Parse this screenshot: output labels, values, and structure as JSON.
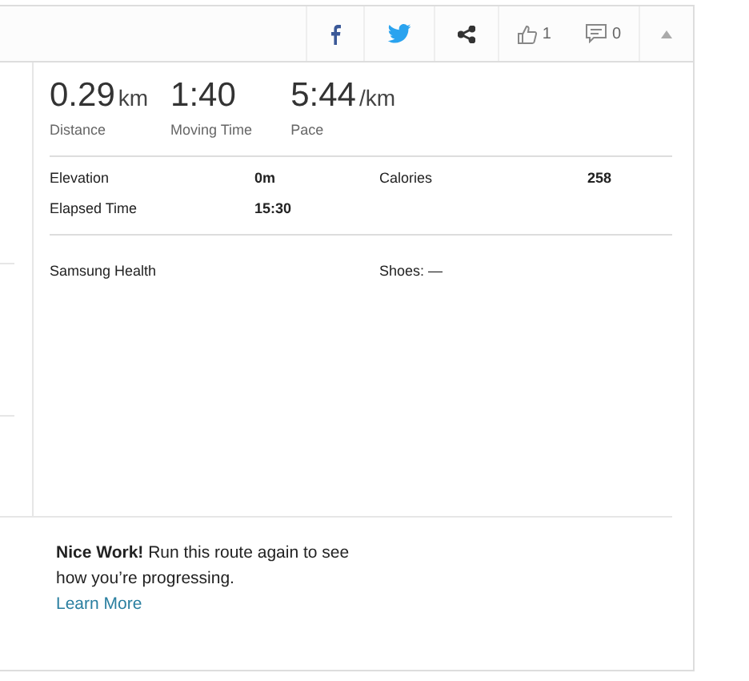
{
  "toolbar": {
    "share_buttons": [
      {
        "kind": "facebook"
      },
      {
        "kind": "twitter"
      },
      {
        "kind": "share"
      }
    ],
    "likes": "1",
    "comments": "0"
  },
  "stats": [
    {
      "value": "0.29",
      "unit": "km",
      "label": "Distance"
    },
    {
      "value": "1:40",
      "label": "Moving Time"
    },
    {
      "value": "5:44",
      "unit": "/km",
      "label": "Pace"
    }
  ],
  "details": [
    {
      "label": "Elevation",
      "value": "0m"
    },
    {
      "label": "Calories",
      "value": "258"
    },
    {
      "label": "Elapsed Time",
      "value": "15:30"
    }
  ],
  "device": "Samsung Health",
  "shoes": "Shoes: —",
  "promo": {
    "text": "**Nice Work!** Run this route again to see how you’re progressing.",
    "link": "Learn More"
  }
}
